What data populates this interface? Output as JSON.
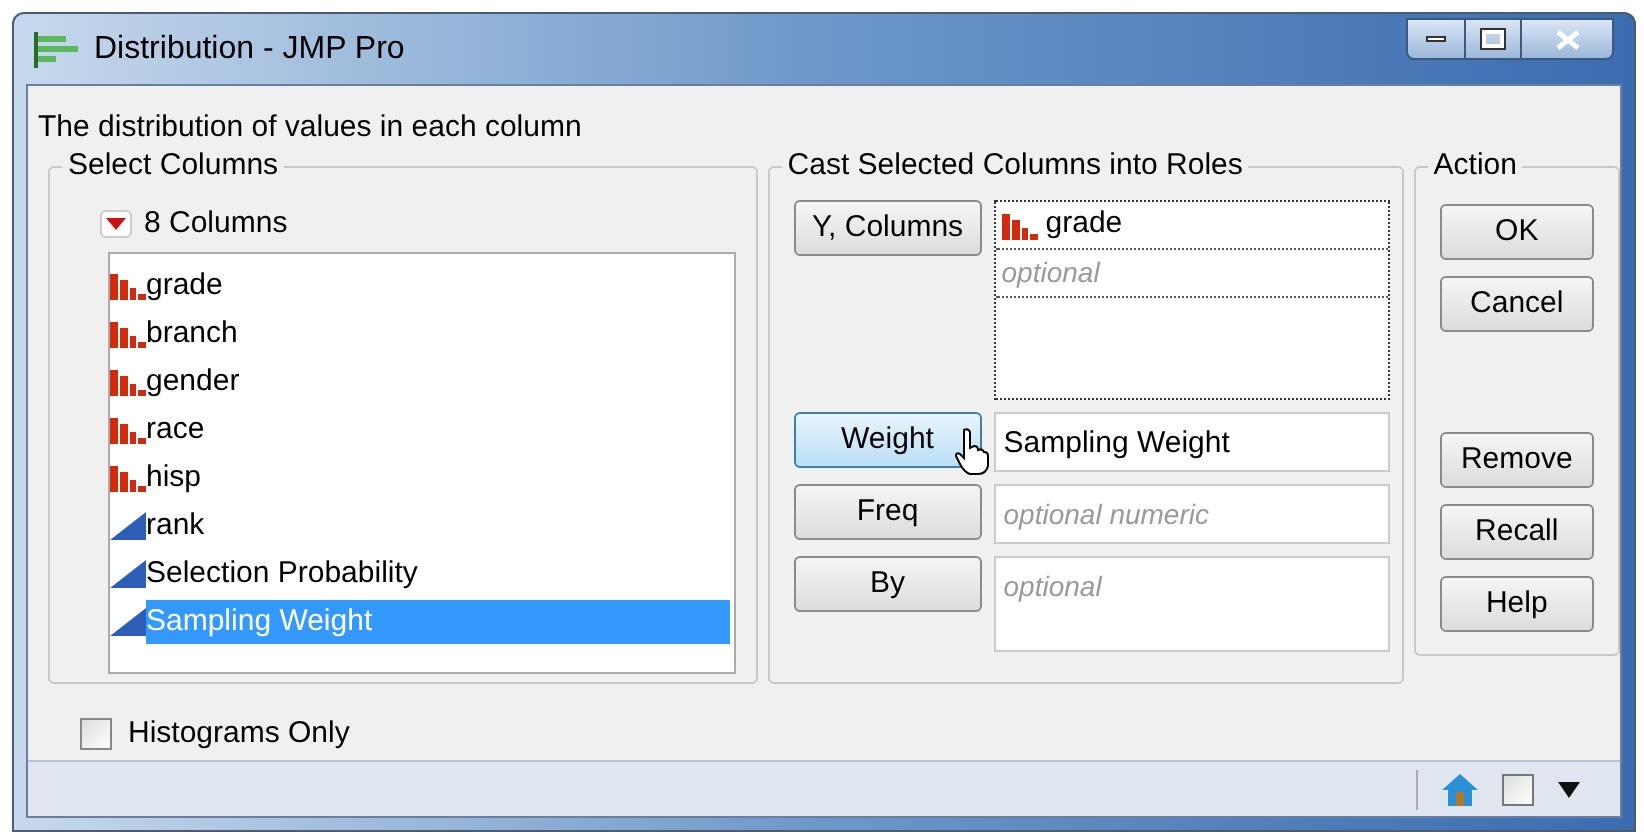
{
  "window": {
    "title": "Distribution - JMP Pro"
  },
  "description": "The distribution of values in each column",
  "select_columns": {
    "title": "Select Columns",
    "group_label": "8 Columns",
    "expanded": true,
    "columns": [
      {
        "name": "grade",
        "kind": "nominal",
        "selected": false
      },
      {
        "name": "branch",
        "kind": "nominal",
        "selected": false
      },
      {
        "name": "gender",
        "kind": "nominal",
        "selected": false
      },
      {
        "name": "race",
        "kind": "nominal",
        "selected": false
      },
      {
        "name": "hisp",
        "kind": "nominal",
        "selected": false
      },
      {
        "name": "rank",
        "kind": "continuous",
        "selected": false
      },
      {
        "name": "Selection Probability",
        "kind": "continuous",
        "selected": false
      },
      {
        "name": "Sampling Weight",
        "kind": "continuous",
        "selected": true
      }
    ]
  },
  "roles": {
    "title": "Cast Selected Columns into Roles",
    "items": [
      {
        "button": "Y, Columns",
        "kind": "list",
        "highlighted": false,
        "values": [
          {
            "name": "grade",
            "kind": "nominal"
          }
        ],
        "placeholder": "optional"
      },
      {
        "button": "Weight",
        "kind": "single",
        "highlighted": true,
        "value": "Sampling Weight"
      },
      {
        "button": "Freq",
        "kind": "single",
        "highlighted": false,
        "placeholder": "optional numeric"
      },
      {
        "button": "By",
        "kind": "multi",
        "highlighted": false,
        "placeholder": "optional"
      }
    ]
  },
  "action": {
    "title": "Action",
    "buttons": [
      "OK",
      "Cancel"
    ],
    "lower_buttons": [
      "Remove",
      "Recall",
      "Help"
    ]
  },
  "histograms_only": {
    "label": "Histograms Only",
    "checked": false
  },
  "status_bar": {
    "checkbox_checked": false
  }
}
